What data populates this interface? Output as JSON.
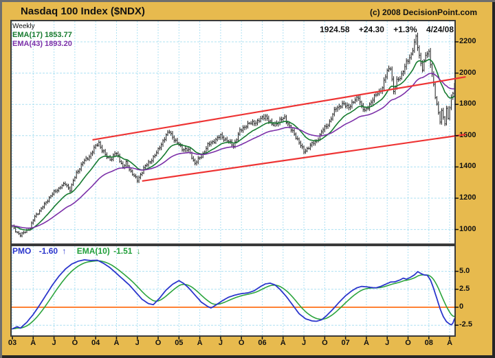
{
  "header": {
    "title": "Nasdaq 100 Index ($NDX)",
    "copyright": "(c) 2008 DecisionPoint.com"
  },
  "quote": {
    "last": "1924.58",
    "change": "+24.30",
    "pct": "+1.3%",
    "date": "4/24/08"
  },
  "price_panel": {
    "timeframe_label": "Weekly",
    "ema_fast_label": "EMA(17) 1853.77",
    "ema_slow_label": "EMA(43) 1893.20"
  },
  "pmo_panel": {
    "pmo_name": "PMO",
    "pmo_value": "-1.60",
    "pmo_arrow": "↑",
    "ema_name": "EMA(10)",
    "ema_value": "-1.51",
    "ema_arrow": "↓"
  },
  "colors": {
    "background_gold": "#e7ba4e",
    "plot_bg": "#ffffff",
    "grid": "#ace0f2",
    "bars": "#1a1a1a",
    "ema17": "#157a2e",
    "ema43": "#7b2fa8",
    "channel_red": "#ee3333",
    "pmo_blue": "#2a35cc",
    "pmo_ema_green": "#2ba43c",
    "zero_orange": "#ff8033",
    "panel_border": "#3a3a3a"
  },
  "chart_data": [
    {
      "type": "ohlc",
      "title": "Nasdaq 100 Index ($NDX) weekly bars with EMA(17), EMA(43) and red trend channel",
      "x_unit": "weeks since Jan 2003",
      "weeks": 276,
      "x_tick_labels": [
        "03",
        "A",
        "J",
        "O",
        "04",
        "A",
        "J",
        "O",
        "05",
        "A",
        "J",
        "O",
        "06",
        "A",
        "J",
        "O",
        "07",
        "A",
        "J",
        "O",
        "08",
        "A"
      ],
      "y_ticks": [
        2200,
        2000,
        1800,
        1600,
        1400,
        1200,
        1000
      ],
      "ylim": [
        906,
        2336
      ],
      "close_anchors": [
        [
          0,
          1020
        ],
        [
          2,
          992
        ],
        [
          5,
          962
        ],
        [
          8,
          988
        ],
        [
          11,
          1008
        ],
        [
          14,
          1085
        ],
        [
          18,
          1130
        ],
        [
          22,
          1190
        ],
        [
          26,
          1238
        ],
        [
          30,
          1272
        ],
        [
          33,
          1292
        ],
        [
          36,
          1255
        ],
        [
          40,
          1360
        ],
        [
          44,
          1428
        ],
        [
          48,
          1468
        ],
        [
          52,
          1532
        ],
        [
          54,
          1556
        ],
        [
          56,
          1508
        ],
        [
          59,
          1462
        ],
        [
          62,
          1452
        ],
        [
          64,
          1488
        ],
        [
          66,
          1470
        ],
        [
          69,
          1398
        ],
        [
          71,
          1424
        ],
        [
          74,
          1372
        ],
        [
          78,
          1312
        ],
        [
          82,
          1392
        ],
        [
          86,
          1436
        ],
        [
          90,
          1488
        ],
        [
          94,
          1568
        ],
        [
          98,
          1628
        ],
        [
          102,
          1562
        ],
        [
          106,
          1518
        ],
        [
          110,
          1506
        ],
        [
          114,
          1424
        ],
        [
          118,
          1468
        ],
        [
          122,
          1538
        ],
        [
          126,
          1568
        ],
        [
          130,
          1598
        ],
        [
          134,
          1568
        ],
        [
          138,
          1536
        ],
        [
          142,
          1628
        ],
        [
          146,
          1668
        ],
        [
          150,
          1682
        ],
        [
          154,
          1696
        ],
        [
          158,
          1728
        ],
        [
          162,
          1668
        ],
        [
          166,
          1688
        ],
        [
          170,
          1716
        ],
        [
          174,
          1638
        ],
        [
          178,
          1578
        ],
        [
          182,
          1496
        ],
        [
          186,
          1538
        ],
        [
          190,
          1568
        ],
        [
          194,
          1638
        ],
        [
          198,
          1688
        ],
        [
          202,
          1778
        ],
        [
          206,
          1798
        ],
        [
          210,
          1788
        ],
        [
          213,
          1812
        ],
        [
          216,
          1852
        ],
        [
          218,
          1788
        ],
        [
          220,
          1752
        ],
        [
          224,
          1818
        ],
        [
          228,
          1872
        ],
        [
          231,
          1908
        ],
        [
          234,
          2012
        ],
        [
          236,
          2042
        ],
        [
          238,
          1878
        ],
        [
          240,
          1948
        ],
        [
          243,
          1992
        ],
        [
          246,
          2062
        ],
        [
          249,
          2122
        ],
        [
          252,
          2225
        ],
        [
          254,
          2108
        ],
        [
          256,
          2032
        ],
        [
          258,
          2112
        ],
        [
          260,
          2128
        ],
        [
          262,
          2002
        ],
        [
          264,
          1848
        ],
        [
          266,
          1738
        ],
        [
          267,
          1696
        ],
        [
          268,
          1762
        ],
        [
          269,
          1722
        ],
        [
          270,
          1682
        ],
        [
          271,
          1762
        ],
        [
          272,
          1706
        ],
        [
          273,
          1782
        ],
        [
          274,
          1842
        ],
        [
          275,
          1882
        ],
        [
          276,
          1925
        ]
      ],
      "ema_overlays": [
        {
          "name": "EMA(17)",
          "period": 17,
          "last_value": 1853.77
        },
        {
          "name": "EMA(43)",
          "period": 43,
          "last_value": 1893.2
        }
      ],
      "trend_channel": {
        "upper": {
          "from_week": 50,
          "from_value": 1573,
          "to_week": 283,
          "to_value": 1976
        },
        "lower": {
          "from_week": 81,
          "from_value": 1310,
          "to_week": 283,
          "to_value": 1608
        }
      },
      "last_quote": {
        "close": 1924.58,
        "change": 24.3,
        "pct_change": 1.3,
        "date": "4/24/08"
      }
    },
    {
      "type": "line",
      "title": "Price Momentum Oscillator (PMO) with EMA(10)",
      "y_ticks": [
        5.0,
        2.5,
        0,
        -2.5
      ],
      "ylim": [
        -4.1,
        8.7
      ],
      "zero_line": 0,
      "series": [
        {
          "name": "PMO",
          "current": -1.6,
          "direction": "up",
          "anchors": [
            [
              0,
              -3.0
            ],
            [
              3,
              -2.7
            ],
            [
              5,
              -2.9
            ],
            [
              9,
              -2.1
            ],
            [
              13,
              -1.0
            ],
            [
              17,
              0.3
            ],
            [
              21,
              1.7
            ],
            [
              25,
              3.1
            ],
            [
              29,
              4.3
            ],
            [
              33,
              5.3
            ],
            [
              37,
              6.0
            ],
            [
              41,
              6.4
            ],
            [
              45,
              6.6
            ],
            [
              49,
              6.5
            ],
            [
              53,
              6.55
            ],
            [
              57,
              6.1
            ],
            [
              61,
              5.5
            ],
            [
              65,
              4.7
            ],
            [
              69,
              3.9
            ],
            [
              73,
              3.1
            ],
            [
              77,
              2.1
            ],
            [
              81,
              1.1
            ],
            [
              85,
              0.5
            ],
            [
              88,
              0.35
            ],
            [
              92,
              1.3
            ],
            [
              96,
              2.4
            ],
            [
              100,
              3.2
            ],
            [
              104,
              3.7
            ],
            [
              107,
              3.3
            ],
            [
              110,
              2.7
            ],
            [
              114,
              1.7
            ],
            [
              118,
              0.7
            ],
            [
              122,
              0.1
            ],
            [
              124,
              -0.1
            ],
            [
              127,
              0.3
            ],
            [
              131,
              0.9
            ],
            [
              135,
              1.4
            ],
            [
              139,
              1.7
            ],
            [
              143,
              1.9
            ],
            [
              147,
              2.0
            ],
            [
              151,
              2.3
            ],
            [
              155,
              2.9
            ],
            [
              158,
              3.25
            ],
            [
              161,
              3.35
            ],
            [
              164,
              3.1
            ],
            [
              167,
              2.5
            ],
            [
              171,
              1.5
            ],
            [
              175,
              0.3
            ],
            [
              179,
              -0.9
            ],
            [
              183,
              -1.6
            ],
            [
              187,
              -1.9
            ],
            [
              190,
              -1.95
            ],
            [
              193,
              -1.75
            ],
            [
              196,
              -1.2
            ],
            [
              200,
              -0.3
            ],
            [
              204,
              0.7
            ],
            [
              208,
              1.6
            ],
            [
              212,
              2.3
            ],
            [
              215,
              2.7
            ],
            [
              218,
              2.9
            ],
            [
              221,
              2.85
            ],
            [
              224,
              2.75
            ],
            [
              227,
              2.7
            ],
            [
              230,
              2.9
            ],
            [
              233,
              3.2
            ],
            [
              236,
              3.5
            ],
            [
              239,
              3.55
            ],
            [
              242,
              3.8
            ],
            [
              244,
              4.05
            ],
            [
              246,
              3.9
            ],
            [
              248,
              4.1
            ],
            [
              251,
              4.5
            ],
            [
              253,
              4.95
            ],
            [
              255,
              4.7
            ],
            [
              257,
              4.5
            ],
            [
              259,
              4.45
            ],
            [
              261,
              3.8
            ],
            [
              263,
              2.6
            ],
            [
              265,
              1.2
            ],
            [
              267,
              -0.2
            ],
            [
              269,
              -1.3
            ],
            [
              271,
              -2.0
            ],
            [
              273,
              -2.35
            ],
            [
              274,
              -2.45
            ],
            [
              275,
              -2.2
            ],
            [
              276,
              -1.6
            ]
          ]
        },
        {
          "name": "EMA(10) of PMO",
          "period": 10,
          "current": -1.51,
          "direction": "down"
        }
      ]
    }
  ]
}
